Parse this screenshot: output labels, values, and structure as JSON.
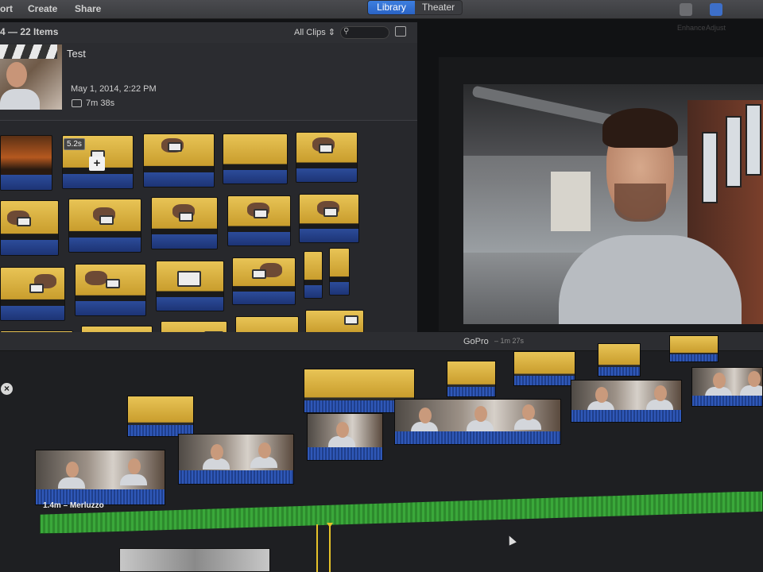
{
  "toolbar": {
    "menu": [
      "ort",
      "Create",
      "Share"
    ],
    "view_tabs": [
      {
        "label": "Library",
        "active": true
      },
      {
        "label": "Theater",
        "active": false
      }
    ],
    "right_labels": [
      "Enhance",
      "Adjust"
    ]
  },
  "browser": {
    "items_count": "4 — 22 Items",
    "filter": "All Clips",
    "search_value": ""
  },
  "event": {
    "title": "Test",
    "date": "May 1, 2014, 2:22 PM",
    "duration": "7m 38s"
  },
  "grid": {
    "skim_duration": "5.2s"
  },
  "timeline": {
    "project_title": "GoPro",
    "project_duration": "1m 27s",
    "music_label": "1.4m – Merluzzo"
  },
  "colors": {
    "accent": "#2a63c4",
    "audio": "#2f58b8",
    "music": "#3aa83a",
    "playhead": "#e6c229"
  }
}
